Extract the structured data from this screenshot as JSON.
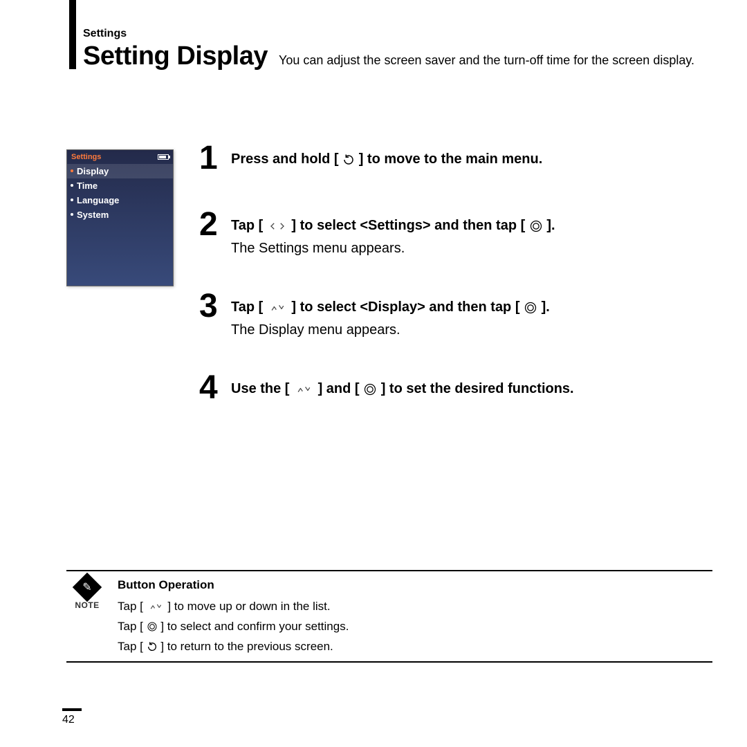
{
  "header": {
    "category": "Settings",
    "title": "Setting Display",
    "subtitle": "You can adjust the screen saver and the turn-off time for the screen display."
  },
  "device": {
    "title": "Settings",
    "items": [
      {
        "label": "Display",
        "selected": true
      },
      {
        "label": "Time",
        "selected": false
      },
      {
        "label": "Language",
        "selected": false
      },
      {
        "label": "System",
        "selected": false
      }
    ]
  },
  "steps": [
    {
      "num": "1",
      "main_pre": "Press and hold [ ",
      "main_icon": "back",
      "main_post": " ] to move to the main menu.",
      "sub": ""
    },
    {
      "num": "2",
      "main_pre": "Tap [ ",
      "main_icon": "leftright",
      "main_mid": " ] to select <Settings> and then tap [ ",
      "main_icon2": "circle",
      "main_post": " ].",
      "sub": "The Settings menu appears."
    },
    {
      "num": "3",
      "main_pre": "Tap [ ",
      "main_icon": "updown",
      "main_mid": " ] to select <Display> and then tap [ ",
      "main_icon2": "circle",
      "main_post": " ].",
      "sub": "The Display menu appears."
    },
    {
      "num": "4",
      "main_pre": "Use the [ ",
      "main_icon": "updown",
      "main_mid": " ] and [ ",
      "main_icon2": "circle",
      "main_post": " ] to set the desired functions.",
      "sub": ""
    }
  ],
  "note": {
    "label": "NOTE",
    "heading": "Button Operation",
    "lines": [
      {
        "pre": "Tap [ ",
        "icon": "updown",
        "post": " ] to move up or down in the list."
      },
      {
        "pre": "Tap [ ",
        "icon": "circle",
        "post": " ] to select and confirm your settings."
      },
      {
        "pre": "Tap [ ",
        "icon": "back",
        "post": " ] to return to the previous screen."
      }
    ]
  },
  "page_number": "42"
}
